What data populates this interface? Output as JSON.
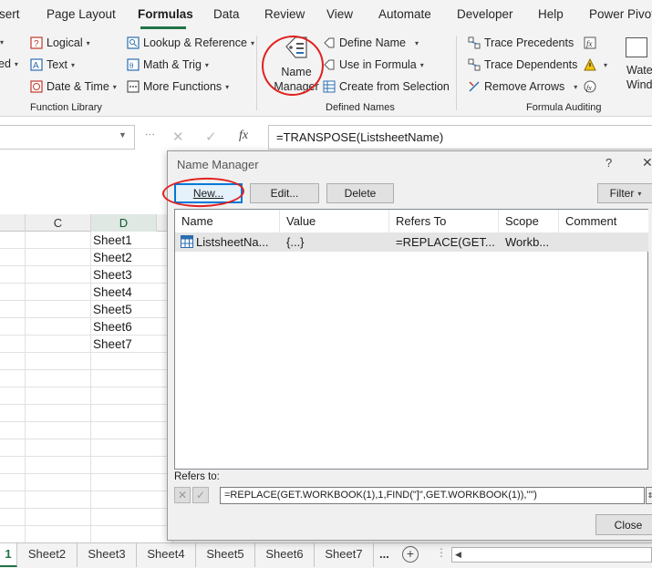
{
  "ribbon_tabs": [
    {
      "label": "sert"
    },
    {
      "label": "Page Layout"
    },
    {
      "label": "Formulas"
    },
    {
      "label": "Data"
    },
    {
      "label": "Review"
    },
    {
      "label": "View"
    },
    {
      "label": "Automate"
    },
    {
      "label": "Developer"
    },
    {
      "label": "Help"
    },
    {
      "label": "Power Pivot"
    }
  ],
  "active_tab": "Formulas",
  "function_library": {
    "group_label": "Function Library",
    "partial_left": [
      "ed"
    ],
    "items": [
      "Logical",
      "Text",
      "Date & Time",
      "Lookup & Reference",
      "Math & Trig",
      "More Functions"
    ]
  },
  "defined_names": {
    "group_label": "Defined Names",
    "name_manager_line1": "Name",
    "name_manager_line2": "Manager",
    "items": [
      "Define Name",
      "Use in Formula",
      "Create from Selection"
    ]
  },
  "formula_auditing": {
    "group_label": "Formula Auditing",
    "items": [
      "Trace Precedents",
      "Trace Dependents",
      "Remove Arrows"
    ],
    "watch_line1": "Wate",
    "watch_line2": "Wind"
  },
  "formula_bar": {
    "fx_label": "fx",
    "formula": "=TRANSPOSE(ListsheetName)"
  },
  "grid": {
    "columns": [
      "C",
      "D"
    ],
    "selected_column": "D",
    "cells_d": [
      "Sheet1",
      "Sheet2",
      "Sheet3",
      "Sheet4",
      "Sheet5",
      "Sheet6",
      "Sheet7"
    ]
  },
  "sheet_tabs": [
    "1",
    "Sheet2",
    "Sheet3",
    "Sheet4",
    "Sheet5",
    "Sheet6",
    "Sheet7"
  ],
  "sheet_more": "...",
  "dialog": {
    "title": "Name Manager",
    "help": "?",
    "new_label": "New...",
    "edit_label": "Edit...",
    "delete_label": "Delete",
    "filter_label": "Filter",
    "columns": [
      "Name",
      "Value",
      "Refers To",
      "Scope",
      "Comment"
    ],
    "rows": [
      {
        "name": "ListsheetNa...",
        "value": "{...}",
        "refers_to": "=REPLACE(GET....",
        "scope": "Workb...",
        "comment": ""
      }
    ],
    "refers_to_label": "Refers to:",
    "refers_to_value": "=REPLACE(GET.WORKBOOK(1),1,FIND(\"]\",GET.WORKBOOK(1)),\"\")",
    "close_label": "Close"
  },
  "colors": {
    "accent": "#217346",
    "annotation": "#e02020",
    "default_button_border": "#0078d7"
  }
}
